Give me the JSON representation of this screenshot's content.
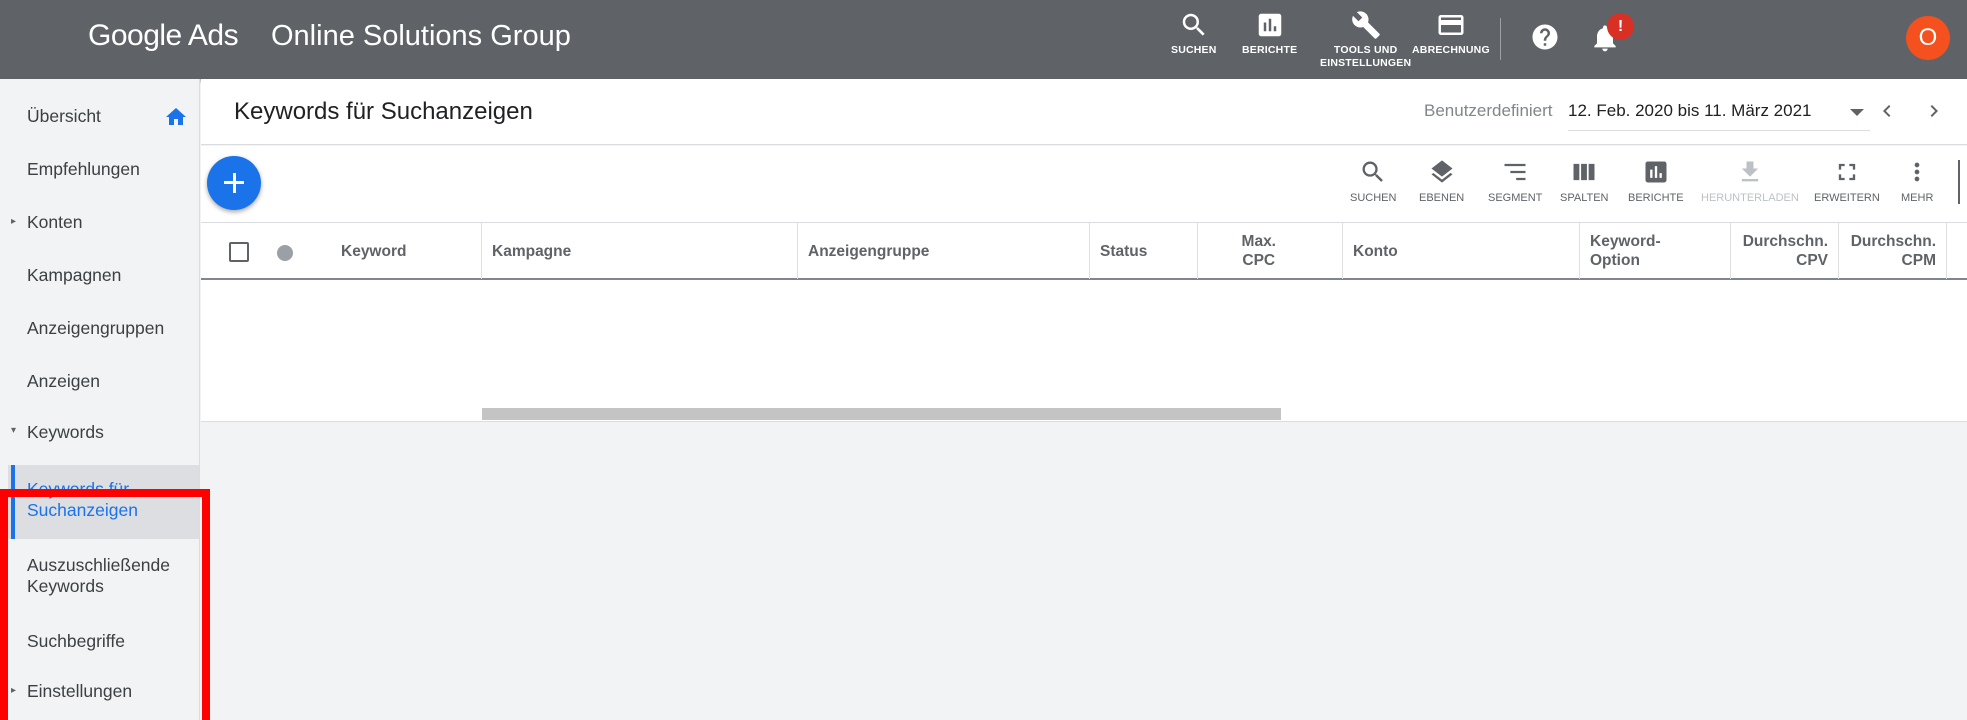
{
  "header": {
    "logo_text": "Google Ads",
    "account_name": "Online Solutions Group",
    "tools": [
      {
        "icon": "search-icon",
        "label": "SUCHEN"
      },
      {
        "icon": "reports-icon",
        "label": "BERICHTE"
      },
      {
        "icon": "wrench-icon",
        "label_line1": "TOOLS UND",
        "label_line2": "EINSTELLUNGEN"
      },
      {
        "icon": "credit-card-icon",
        "label": "ABRECHNUNG"
      }
    ],
    "notification_badge": "!",
    "avatar_letter": "O"
  },
  "sidebar": {
    "items": [
      {
        "label": "Übersicht"
      },
      {
        "label": "Empfehlungen"
      },
      {
        "label": "Konten"
      },
      {
        "label": "Kampagnen"
      },
      {
        "label": "Anzeigengruppen"
      },
      {
        "label": "Anzeigen"
      },
      {
        "label": "Keywords"
      },
      {
        "label_line1": "Keywords für",
        "label_line2": "Suchanzeigen"
      },
      {
        "label_line1": "Auszuschließende",
        "label_line2": "Keywords"
      },
      {
        "label": "Suchbegriffe"
      },
      {
        "label": "Einstellungen"
      }
    ]
  },
  "main": {
    "title": "Keywords für Suchanzeigen",
    "date_label": "Benutzerdefiniert",
    "date_range": "12. Feb. 2020 bis 11. März 2021",
    "toolbar": [
      {
        "icon": "search-icon",
        "label": "SUCHEN"
      },
      {
        "icon": "layers-icon",
        "label": "EBENEN"
      },
      {
        "icon": "segment-icon",
        "label": "SEGMENT"
      },
      {
        "icon": "columns-icon",
        "label": "SPALTEN"
      },
      {
        "icon": "reports-icon",
        "label": "BERICHTE"
      },
      {
        "icon": "download-icon",
        "label": "HERUNTERLADEN"
      },
      {
        "icon": "expand-icon",
        "label": "ERWEITERN"
      },
      {
        "icon": "more-icon",
        "label": "MEHR"
      }
    ],
    "columns": [
      {
        "label": "Keyword"
      },
      {
        "label": "Kampagne"
      },
      {
        "label": "Anzeigengruppe"
      },
      {
        "label": "Status"
      },
      {
        "label_line1": "Max.",
        "label_line2": "CPC"
      },
      {
        "label": "Konto"
      },
      {
        "label_line1": "Keyword-",
        "label_line2": "Option"
      },
      {
        "label_line1": "Durchschn.",
        "label_line2": "CPV"
      },
      {
        "label_line1": "Durchschn.",
        "label_line2": "CPM"
      }
    ]
  },
  "colors": {
    "header_bg": "#5f6368",
    "accent": "#1a73e8",
    "highlight_box": "#ff0000",
    "avatar": "#f4511e",
    "badge": "#d93025"
  }
}
